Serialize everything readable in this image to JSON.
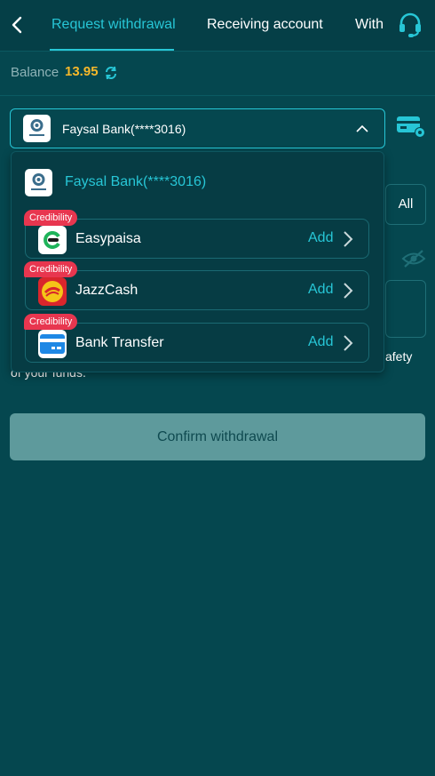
{
  "nav": {
    "tabs": [
      {
        "label": "Request withdrawal",
        "active": true
      },
      {
        "label": "Receiving account",
        "active": false
      },
      {
        "label": "With",
        "active": false
      }
    ]
  },
  "balance": {
    "label": "Balance",
    "value": "13.95"
  },
  "selector": {
    "selected_account": "Faysal Bank(****3016)"
  },
  "background": {
    "filter_all": "All",
    "note_tail": "afety",
    "note_line2": "of your funds."
  },
  "dropdown": {
    "current_account": "Faysal Bank(****3016)",
    "wallets": [
      {
        "name": "Easypaisa",
        "badge": "Credibility",
        "action": "Add",
        "icon": "easypaisa-icon"
      },
      {
        "name": "JazzCash",
        "badge": "Credibility",
        "action": "Add",
        "icon": "jazzcash-icon"
      },
      {
        "name": "Bank Transfer",
        "badge": "Credibility",
        "action": "Add",
        "icon": "bank-card-icon"
      }
    ]
  },
  "confirm_button": "Confirm withdrawal",
  "colors": {
    "background": "#05474f",
    "accent": "#27c6d6",
    "balance": "#f7b82a",
    "badge": "#e8364f",
    "confirm_button": "#5e9a9c"
  }
}
